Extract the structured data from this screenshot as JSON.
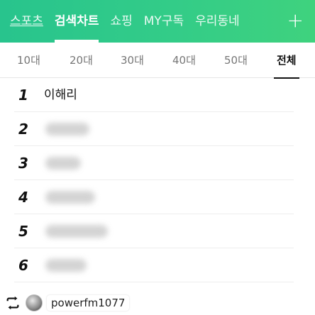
{
  "top_nav": {
    "tabs": [
      {
        "label": "스포츠"
      },
      {
        "label": "검색차트"
      },
      {
        "label": "쇼핑"
      },
      {
        "label": "MY구독"
      },
      {
        "label": "우리동네"
      }
    ],
    "active_index": 1,
    "add_label": "+",
    "accent_color": "#33cc88"
  },
  "age_filter": {
    "options": [
      "10대",
      "20대",
      "30대",
      "40대",
      "50대",
      "전체"
    ],
    "active_index": 5
  },
  "ranking": {
    "items": [
      {
        "rank": "1",
        "term": "이해리"
      },
      {
        "rank": "2",
        "term": ""
      },
      {
        "rank": "3",
        "term": ""
      },
      {
        "rank": "4",
        "term": ""
      },
      {
        "rank": "5",
        "term": ""
      },
      {
        "rank": "6",
        "term": ""
      }
    ]
  },
  "footer": {
    "repost_icon": "repost-icon",
    "username": "powerfm1077"
  }
}
